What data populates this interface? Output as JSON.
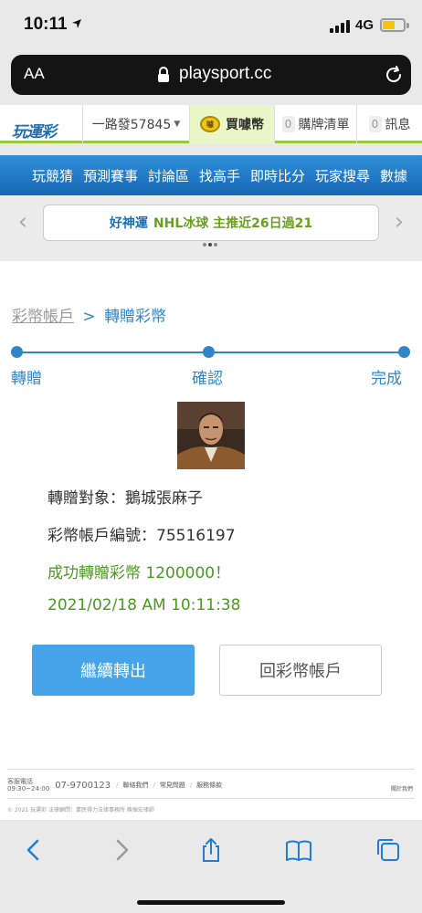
{
  "status_bar": {
    "time": "10:11",
    "network": "4G"
  },
  "browser": {
    "text_size": "AA",
    "url": "playsport.cc"
  },
  "header": {
    "logo": "玩運彩",
    "username": "一路發57845",
    "buy_coin": "買噱幣",
    "coin_badge": "噱",
    "cart_count": "0",
    "cart_label": "購牌清單",
    "msg_count": "0",
    "msg_label": "訊息"
  },
  "nav": {
    "items": [
      "玩競猜",
      "預測賽事",
      "討論區",
      "找高手",
      "即時比分",
      "玩家搜尋",
      "數據"
    ]
  },
  "marquee": {
    "lead": "好神運",
    "text": "NHL冰球 主推近26日過21"
  },
  "breadcrumb": {
    "parent": "彩幣帳戶",
    "separator": ">",
    "current": "轉贈彩幣"
  },
  "steps": [
    "轉贈",
    "確認",
    "完成"
  ],
  "result": {
    "recipient_label": "轉贈對象：",
    "recipient": "鵝城張麻子",
    "account_label": "彩幣帳戶編號：",
    "account": "75516197",
    "success": "成功轉贈彩幣 1200000！",
    "timestamp": "2021/02/18 AM 10:11:38"
  },
  "buttons": {
    "continue": "繼續轉出",
    "back": "回彩幣帳戶"
  },
  "footer": {
    "service_label": "客服電話",
    "service_hours": "09:30~24:00",
    "phone": "07-9700123",
    "links": [
      "聯絡我們",
      "常見問題",
      "服務條款"
    ],
    "about": "關於我們",
    "copyright": "© 2021 玩運彩 法律顧問：業民得力法律事務所 陳振宏律師"
  },
  "colors": {
    "accent": "#2f86c9",
    "success": "#4a9a1f",
    "primary_button": "#45a3e8",
    "nav": "#1f76c2"
  }
}
